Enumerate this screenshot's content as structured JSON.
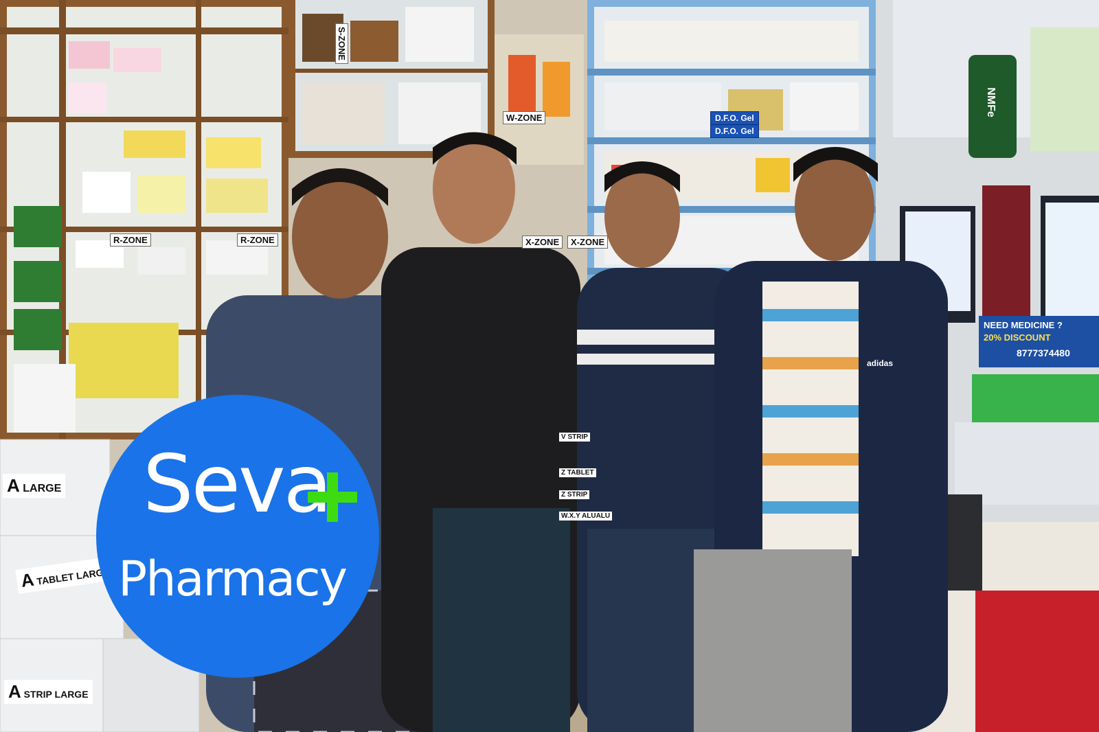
{
  "logo": {
    "line1": "Seva",
    "line2": "Pharmacy",
    "circle_color": "#1a73e8",
    "plus_color": "#3ddc12",
    "plus_icon": "medical-plus-icon"
  },
  "shelf_labels": [
    "R-ZONE",
    "R-ZONE",
    "X-ZONE",
    "X-ZONE",
    "W-ZONE",
    "S-ZONE"
  ],
  "product_labels": [
    "D.F.O. Gel",
    "D.F.O. Gel",
    "NMFe"
  ],
  "bin_labels": [
    {
      "letter": "A",
      "text": "LARGE"
    },
    {
      "letter": "A",
      "text": "TABLET LARGE"
    },
    {
      "letter": "A",
      "text": "STRIP LARGE"
    },
    {
      "letter": "V",
      "text": "STRIP"
    },
    {
      "letter": "Z",
      "text": "TABLET"
    },
    {
      "letter": "Z",
      "text": "STRIP"
    },
    {
      "letter": "W.X.Y",
      "text": "ALUALU"
    }
  ],
  "ad_banner": {
    "line1": "NEED MEDICINE ?",
    "line2": "20% DISCOUNT",
    "phone": "8777374480"
  },
  "clothing_logo": "adidas"
}
